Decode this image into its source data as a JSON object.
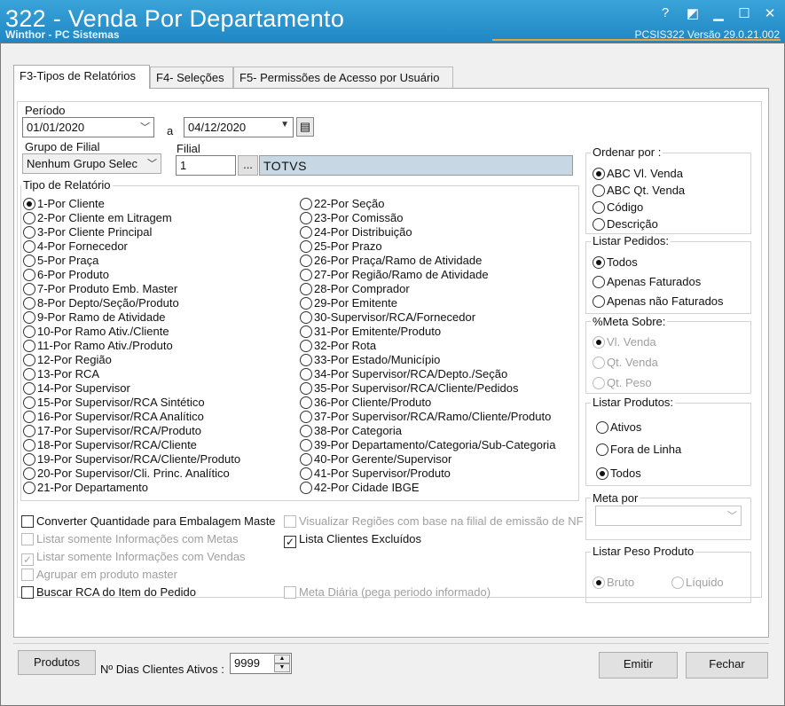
{
  "window": {
    "title": "322 - Venda Por Departamento",
    "subtitle": "Winthor - PC Sistemas",
    "version": "PCSIS322  Versão  29.0.21.002",
    "help_glyph": "?",
    "restore_glyph": "◩",
    "minimize_glyph": "▁",
    "maximize_glyph": "☐",
    "close_glyph": "✕"
  },
  "tabs": [
    {
      "label": "F3-Tipos de Relatórios"
    },
    {
      "label": "F4- Seleções"
    },
    {
      "label": "F5- Permissões de Acesso por Usuário"
    }
  ],
  "periodo": {
    "label": "Período",
    "from": "01/01/2020",
    "sep": "a",
    "to": "04/12/2020"
  },
  "grupo_filial": {
    "label": "Grupo de Filial",
    "value": "Nenhum Grupo Selec"
  },
  "filial": {
    "label": "Filial",
    "code": "1",
    "browse": "...",
    "name": "TOTVS"
  },
  "tipo_relatorio": {
    "label": "Tipo de Relatório",
    "col1": [
      "1-Por Cliente",
      "2-Por Cliente em Litragem",
      "3-Por Cliente Principal",
      "4-Por Fornecedor",
      "5-Por Praça",
      "6-Por Produto",
      "7-Por Produto Emb. Master",
      "8-Por Depto/Seção/Produto",
      "9-Por Ramo de Atividade",
      "10-Por Ramo Ativ./Cliente",
      "11-Por Ramo Ativ./Produto",
      "12-Por Região",
      "13-Por RCA",
      "14-Por Supervisor",
      "15-Por Supervisor/RCA Sintético",
      "16-Por Supervisor/RCA Analítico",
      "17-Por Supervisor/RCA/Produto",
      "18-Por Supervisor/RCA/Cliente",
      "19-Por Supervisor/RCA/Cliente/Produto",
      "20-Por Supervisor/Cli. Princ. Analítico",
      "21-Por Departamento"
    ],
    "col2": [
      "22-Por Seção",
      "23-Por Comissão",
      "24-Por Distribuição",
      "25-Por Prazo",
      "26-Por Praça/Ramo de Atividade",
      "27-Por Região/Ramo de Atividade",
      "28-Por Comprador",
      "29-Por Emitente",
      "30-Supervisor/RCA/Fornecedor",
      "31-Por Emitente/Produto",
      "32-Por Rota",
      "33-Por Estado/Município",
      "34-Por Supervisor/RCA/Depto./Seção",
      "35-Por Supervisor/RCA/Cliente/Pedidos",
      "36-Por Cliente/Produto",
      "37-Por Supervisor/RCA/Ramo/Cliente/Produto",
      "38-Por Categoria",
      "39-Por Departamento/Categoria/Sub-Categoria",
      "40-Por Gerente/Supervisor",
      "41-Por Supervisor/Produto",
      "42-Por Cidade IBGE"
    ],
    "selected": "1-Por Cliente"
  },
  "options": {
    "converter": "Converter Quantidade para Embalagem Maste",
    "listar_metas": "Listar somente Informações com Metas",
    "listar_vendas": "Listar somente Informações com Vendas",
    "agrupar": "Agrupar em produto master",
    "buscar_rca": "Buscar RCA do Item do Pedido",
    "visualizar_regioes": "Visualizar Regiões com base na filial de emissão de NF",
    "lista_excluidos": "Lista Clientes Excluídos",
    "meta_diaria": "Meta Diária (pega periodo informado)",
    "check_mark": "✓"
  },
  "ordenar_por": {
    "label": "Ordenar por :",
    "items": [
      "ABC Vl. Venda",
      "ABC Qt. Venda",
      "Código",
      "Descrição"
    ]
  },
  "listar_pedidos": {
    "label": "Listar Pedidos:",
    "items": [
      "Todos",
      "Apenas Faturados",
      "Apenas não Faturados"
    ]
  },
  "meta_sobre": {
    "label": "%Meta Sobre:",
    "items": [
      "Vl. Venda",
      "Qt. Venda",
      "Qt. Peso"
    ]
  },
  "listar_produtos": {
    "label": "Listar Produtos:",
    "items": [
      "Ativos",
      "Fora de Linha",
      "Todos"
    ]
  },
  "meta_por": {
    "label": "Meta por",
    "value": ""
  },
  "listar_peso": {
    "label": "Listar Peso Produto",
    "items": [
      "Bruto",
      "Líquido"
    ]
  },
  "bottom": {
    "produtos": "Produtos",
    "dias_label": "Nº Dias Clientes Ativos :",
    "dias_value": "9999",
    "emitir": "Emitir",
    "fechar": "Fechar"
  }
}
